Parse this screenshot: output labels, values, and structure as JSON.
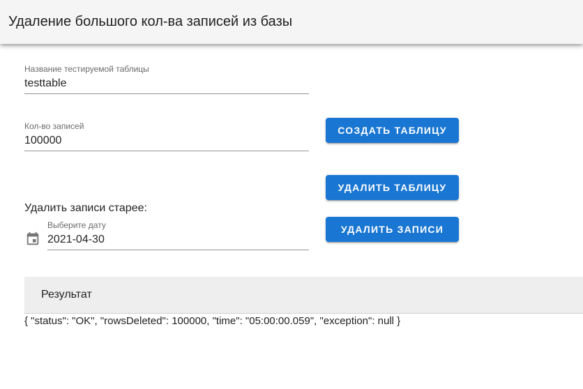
{
  "header": {
    "title": "Удаление большого кол-ва записей из базы"
  },
  "form": {
    "table_name": {
      "label": "Название тестируемой таблицы",
      "value": "testtable"
    },
    "records_count": {
      "label": "Кол-во записей",
      "value": "100000"
    },
    "delete_older_label": "Удалить записи старее:",
    "date": {
      "label": "Выберите дату",
      "value": "2021-04-30",
      "icon": "calendar-icon"
    }
  },
  "buttons": {
    "create_table": "СОЗДАТЬ ТАБЛИЦУ",
    "delete_table": "УДАЛИТЬ ТАБЛИЦУ",
    "delete_records": "УДАЛИТЬ ЗАПИСИ"
  },
  "result": {
    "title": "Результат",
    "text": "{ \"status\": \"OK\", \"rowsDeleted\": 100000, \"time\": \"05:00:00.059\", \"exception\": null }"
  },
  "colors": {
    "primary": "#1976d2",
    "appbar": "#f5f5f5",
    "result_header": "#eeeeee"
  }
}
